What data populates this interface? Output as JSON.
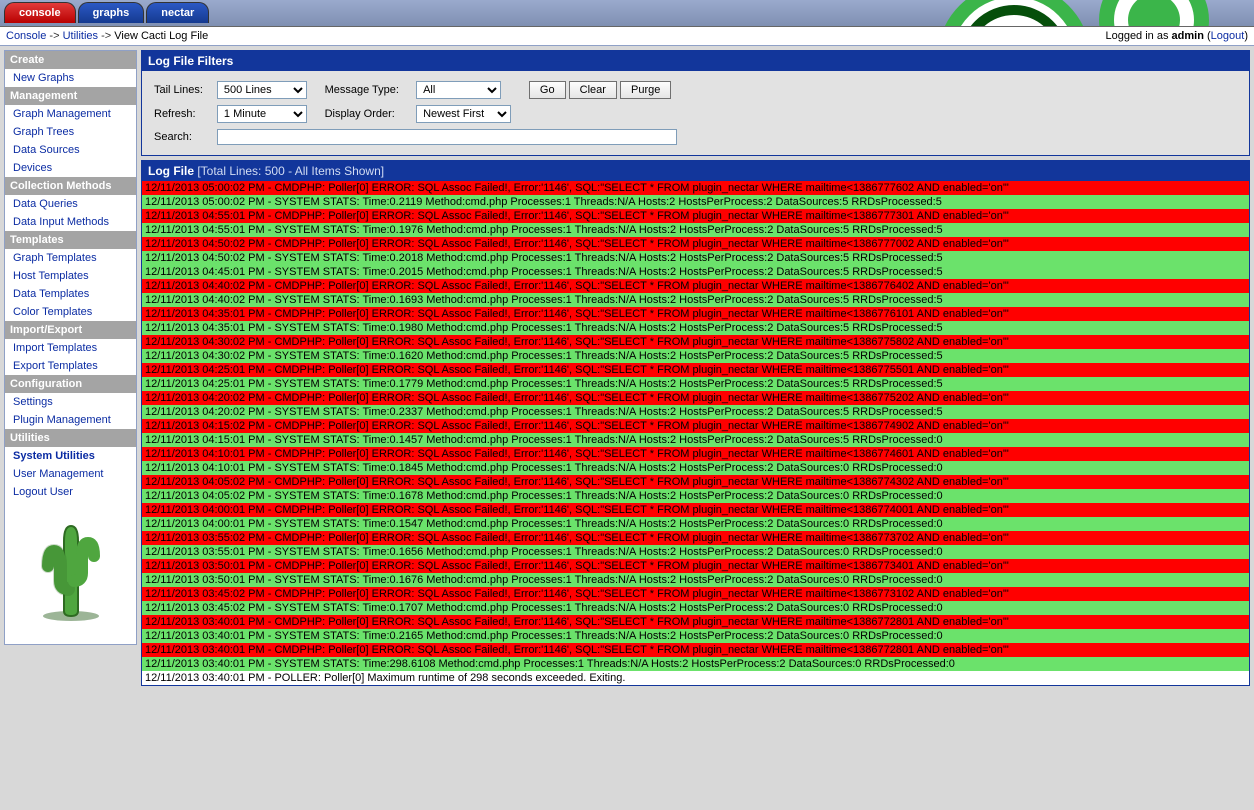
{
  "tabs": {
    "console": "console",
    "graphs": "graphs",
    "nectar": "nectar"
  },
  "breadcrumb": {
    "console": "Console",
    "utilities": "Utilities",
    "view": "View Cacti Log File",
    "sep": "->"
  },
  "logged": {
    "prefix": "Logged in as ",
    "user": "admin",
    "logout": "Logout"
  },
  "sidebar": {
    "s0": "Create",
    "i0": "New Graphs",
    "s1": "Management",
    "i1": "Graph Management",
    "i2": "Graph Trees",
    "i3": "Data Sources",
    "i4": "Devices",
    "s2": "Collection Methods",
    "i5": "Data Queries",
    "i6": "Data Input Methods",
    "s3": "Templates",
    "i7": "Graph Templates",
    "i8": "Host Templates",
    "i9": "Data Templates",
    "i10": "Color Templates",
    "s4": "Import/Export",
    "i11": "Import Templates",
    "i12": "Export Templates",
    "s5": "Configuration",
    "i13": "Settings",
    "i14": "Plugin Management",
    "s6": "Utilities",
    "i15": "System Utilities",
    "i16": "User Management",
    "i17": "Logout User"
  },
  "filters": {
    "header": "Log File Filters",
    "tail_label": "Tail Lines:",
    "tail_value": "500 Lines",
    "msgtype_label": "Message Type:",
    "msgtype_value": "All",
    "go": "Go",
    "clear": "Clear",
    "purge": "Purge",
    "refresh_label": "Refresh:",
    "refresh_value": "1 Minute",
    "order_label": "Display Order:",
    "order_value": "Newest First",
    "search_label": "Search:",
    "search_value": ""
  },
  "logpanel": {
    "header": "Log File",
    "sub": "[Total Lines: 500 - All Items Shown]"
  },
  "log": [
    {
      "c": "error",
      "t": "12/11/2013 05:00:02 PM - CMDPHP: Poller[0] ERROR: SQL Assoc Failed!, Error:'1146', SQL:\"SELECT * FROM plugin_nectar WHERE mailtime<1386777602 AND enabled='on'\""
    },
    {
      "c": "stats",
      "t": "12/11/2013 05:00:02 PM - SYSTEM STATS: Time:0.2119 Method:cmd.php Processes:1 Threads:N/A Hosts:2 HostsPerProcess:2 DataSources:5 RRDsProcessed:5"
    },
    {
      "c": "error",
      "t": "12/11/2013 04:55:01 PM - CMDPHP: Poller[0] ERROR: SQL Assoc Failed!, Error:'1146', SQL:\"SELECT * FROM plugin_nectar WHERE mailtime<1386777301 AND enabled='on'\""
    },
    {
      "c": "stats",
      "t": "12/11/2013 04:55:01 PM - SYSTEM STATS: Time:0.1976 Method:cmd.php Processes:1 Threads:N/A Hosts:2 HostsPerProcess:2 DataSources:5 RRDsProcessed:5"
    },
    {
      "c": "error",
      "t": "12/11/2013 04:50:02 PM - CMDPHP: Poller[0] ERROR: SQL Assoc Failed!, Error:'1146', SQL:\"SELECT * FROM plugin_nectar WHERE mailtime<1386777002 AND enabled='on'\""
    },
    {
      "c": "stats",
      "t": "12/11/2013 04:50:02 PM - SYSTEM STATS: Time:0.2018 Method:cmd.php Processes:1 Threads:N/A Hosts:2 HostsPerProcess:2 DataSources:5 RRDsProcessed:5"
    },
    {
      "c": "stats",
      "t": "12/11/2013 04:45:01 PM - SYSTEM STATS: Time:0.2015 Method:cmd.php Processes:1 Threads:N/A Hosts:2 HostsPerProcess:2 DataSources:5 RRDsProcessed:5"
    },
    {
      "c": "error",
      "t": "12/11/2013 04:40:02 PM - CMDPHP: Poller[0] ERROR: SQL Assoc Failed!, Error:'1146', SQL:\"SELECT * FROM plugin_nectar WHERE mailtime<1386776402 AND enabled='on'\""
    },
    {
      "c": "stats",
      "t": "12/11/2013 04:40:02 PM - SYSTEM STATS: Time:0.1693 Method:cmd.php Processes:1 Threads:N/A Hosts:2 HostsPerProcess:2 DataSources:5 RRDsProcessed:5"
    },
    {
      "c": "error",
      "t": "12/11/2013 04:35:01 PM - CMDPHP: Poller[0] ERROR: SQL Assoc Failed!, Error:'1146', SQL:\"SELECT * FROM plugin_nectar WHERE mailtime<1386776101 AND enabled='on'\""
    },
    {
      "c": "stats",
      "t": "12/11/2013 04:35:01 PM - SYSTEM STATS: Time:0.1980 Method:cmd.php Processes:1 Threads:N/A Hosts:2 HostsPerProcess:2 DataSources:5 RRDsProcessed:5"
    },
    {
      "c": "error",
      "t": "12/11/2013 04:30:02 PM - CMDPHP: Poller[0] ERROR: SQL Assoc Failed!, Error:'1146', SQL:\"SELECT * FROM plugin_nectar WHERE mailtime<1386775802 AND enabled='on'\""
    },
    {
      "c": "stats",
      "t": "12/11/2013 04:30:02 PM - SYSTEM STATS: Time:0.1620 Method:cmd.php Processes:1 Threads:N/A Hosts:2 HostsPerProcess:2 DataSources:5 RRDsProcessed:5"
    },
    {
      "c": "error",
      "t": "12/11/2013 04:25:01 PM - CMDPHP: Poller[0] ERROR: SQL Assoc Failed!, Error:'1146', SQL:\"SELECT * FROM plugin_nectar WHERE mailtime<1386775501 AND enabled='on'\""
    },
    {
      "c": "stats",
      "t": "12/11/2013 04:25:01 PM - SYSTEM STATS: Time:0.1779 Method:cmd.php Processes:1 Threads:N/A Hosts:2 HostsPerProcess:2 DataSources:5 RRDsProcessed:5"
    },
    {
      "c": "error",
      "t": "12/11/2013 04:20:02 PM - CMDPHP: Poller[0] ERROR: SQL Assoc Failed!, Error:'1146', SQL:\"SELECT * FROM plugin_nectar WHERE mailtime<1386775202 AND enabled='on'\""
    },
    {
      "c": "stats",
      "t": "12/11/2013 04:20:02 PM - SYSTEM STATS: Time:0.2337 Method:cmd.php Processes:1 Threads:N/A Hosts:2 HostsPerProcess:2 DataSources:5 RRDsProcessed:5"
    },
    {
      "c": "error",
      "t": "12/11/2013 04:15:02 PM - CMDPHP: Poller[0] ERROR: SQL Assoc Failed!, Error:'1146', SQL:\"SELECT * FROM plugin_nectar WHERE mailtime<1386774902 AND enabled='on'\""
    },
    {
      "c": "stats",
      "t": "12/11/2013 04:15:01 PM - SYSTEM STATS: Time:0.1457 Method:cmd.php Processes:1 Threads:N/A Hosts:2 HostsPerProcess:2 DataSources:5 RRDsProcessed:0"
    },
    {
      "c": "error",
      "t": "12/11/2013 04:10:01 PM - CMDPHP: Poller[0] ERROR: SQL Assoc Failed!, Error:'1146', SQL:\"SELECT * FROM plugin_nectar WHERE mailtime<1386774601 AND enabled='on'\""
    },
    {
      "c": "stats",
      "t": "12/11/2013 04:10:01 PM - SYSTEM STATS: Time:0.1845 Method:cmd.php Processes:1 Threads:N/A Hosts:2 HostsPerProcess:2 DataSources:0 RRDsProcessed:0"
    },
    {
      "c": "error",
      "t": "12/11/2013 04:05:02 PM - CMDPHP: Poller[0] ERROR: SQL Assoc Failed!, Error:'1146', SQL:\"SELECT * FROM plugin_nectar WHERE mailtime<1386774302 AND enabled='on'\""
    },
    {
      "c": "stats",
      "t": "12/11/2013 04:05:02 PM - SYSTEM STATS: Time:0.1678 Method:cmd.php Processes:1 Threads:N/A Hosts:2 HostsPerProcess:2 DataSources:0 RRDsProcessed:0"
    },
    {
      "c": "error",
      "t": "12/11/2013 04:00:01 PM - CMDPHP: Poller[0] ERROR: SQL Assoc Failed!, Error:'1146', SQL:\"SELECT * FROM plugin_nectar WHERE mailtime<1386774001 AND enabled='on'\""
    },
    {
      "c": "stats",
      "t": "12/11/2013 04:00:01 PM - SYSTEM STATS: Time:0.1547 Method:cmd.php Processes:1 Threads:N/A Hosts:2 HostsPerProcess:2 DataSources:0 RRDsProcessed:0"
    },
    {
      "c": "error",
      "t": "12/11/2013 03:55:02 PM - CMDPHP: Poller[0] ERROR: SQL Assoc Failed!, Error:'1146', SQL:\"SELECT * FROM plugin_nectar WHERE mailtime<1386773702 AND enabled='on'\""
    },
    {
      "c": "stats",
      "t": "12/11/2013 03:55:01 PM - SYSTEM STATS: Time:0.1656 Method:cmd.php Processes:1 Threads:N/A Hosts:2 HostsPerProcess:2 DataSources:0 RRDsProcessed:0"
    },
    {
      "c": "error",
      "t": "12/11/2013 03:50:01 PM - CMDPHP: Poller[0] ERROR: SQL Assoc Failed!, Error:'1146', SQL:\"SELECT * FROM plugin_nectar WHERE mailtime<1386773401 AND enabled='on'\""
    },
    {
      "c": "stats",
      "t": "12/11/2013 03:50:01 PM - SYSTEM STATS: Time:0.1676 Method:cmd.php Processes:1 Threads:N/A Hosts:2 HostsPerProcess:2 DataSources:0 RRDsProcessed:0"
    },
    {
      "c": "error",
      "t": "12/11/2013 03:45:02 PM - CMDPHP: Poller[0] ERROR: SQL Assoc Failed!, Error:'1146', SQL:\"SELECT * FROM plugin_nectar WHERE mailtime<1386773102 AND enabled='on'\""
    },
    {
      "c": "stats",
      "t": "12/11/2013 03:45:02 PM - SYSTEM STATS: Time:0.1707 Method:cmd.php Processes:1 Threads:N/A Hosts:2 HostsPerProcess:2 DataSources:0 RRDsProcessed:0"
    },
    {
      "c": "error",
      "t": "12/11/2013 03:40:01 PM - CMDPHP: Poller[0] ERROR: SQL Assoc Failed!, Error:'1146', SQL:\"SELECT * FROM plugin_nectar WHERE mailtime<1386772801 AND enabled='on'\""
    },
    {
      "c": "stats",
      "t": "12/11/2013 03:40:01 PM - SYSTEM STATS: Time:0.2165 Method:cmd.php Processes:1 Threads:N/A Hosts:2 HostsPerProcess:2 DataSources:0 RRDsProcessed:0"
    },
    {
      "c": "error",
      "t": "12/11/2013 03:40:01 PM - CMDPHP: Poller[0] ERROR: SQL Assoc Failed!, Error:'1146', SQL:\"SELECT * FROM plugin_nectar WHERE mailtime<1386772801 AND enabled='on'\""
    },
    {
      "c": "stats",
      "t": "12/11/2013 03:40:01 PM - SYSTEM STATS: Time:298.6108 Method:cmd.php Processes:1 Threads:N/A Hosts:2 HostsPerProcess:2 DataSources:0 RRDsProcessed:0"
    },
    {
      "c": "plain",
      "t": "12/11/2013 03:40:01 PM - POLLER: Poller[0] Maximum runtime of 298 seconds exceeded. Exiting."
    }
  ]
}
